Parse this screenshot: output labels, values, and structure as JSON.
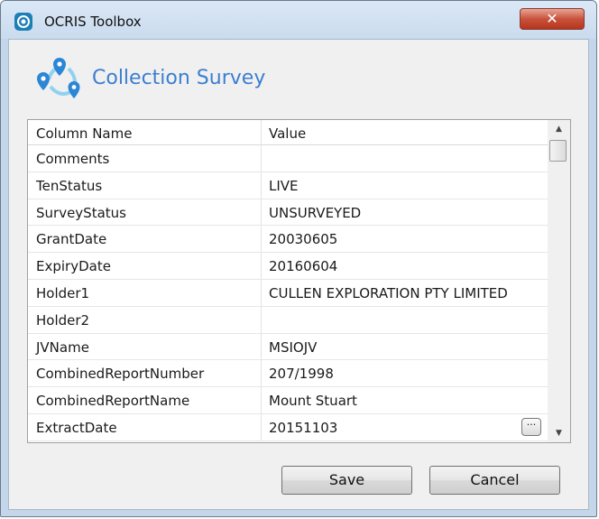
{
  "window": {
    "title": "OCRIS Toolbox",
    "close_glyph": "✕"
  },
  "header": {
    "title": "Collection Survey",
    "icon": "map-pins-icon"
  },
  "grid": {
    "columns": [
      "Column Name",
      "Value"
    ],
    "rows": [
      {
        "name": "Comments",
        "value": ""
      },
      {
        "name": "TenStatus",
        "value": "LIVE"
      },
      {
        "name": "SurveyStatus",
        "value": "UNSURVEYED"
      },
      {
        "name": "GrantDate",
        "value": "20030605"
      },
      {
        "name": "ExpiryDate",
        "value": "20160604"
      },
      {
        "name": "Holder1",
        "value": "CULLEN EXPLORATION PTY LIMITED"
      },
      {
        "name": "Holder2",
        "value": ""
      },
      {
        "name": "JVName",
        "value": "MSIOJV"
      },
      {
        "name": "CombinedReportNumber",
        "value": "207/1998"
      },
      {
        "name": "CombinedReportName",
        "value": "Mount Stuart"
      },
      {
        "name": "ExtractDate",
        "value": "20151103"
      }
    ],
    "ellipsis_label": "···",
    "scroll_up_glyph": "▲",
    "scroll_down_glyph": "▼"
  },
  "buttons": {
    "save": "Save",
    "cancel": "Cancel"
  },
  "colors": {
    "title_accent": "#3b7fd0",
    "close_red": "#c9523c"
  }
}
